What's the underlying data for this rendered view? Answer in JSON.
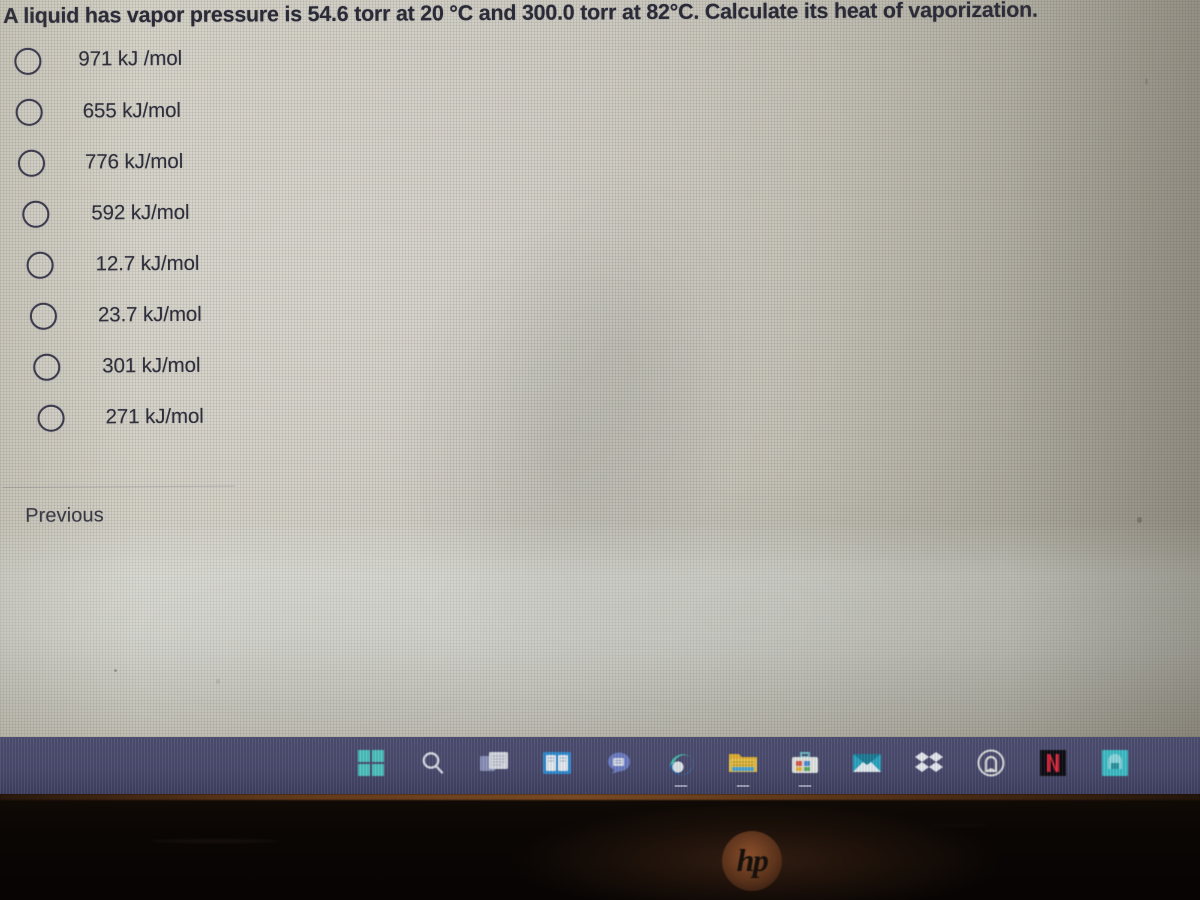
{
  "question": {
    "text": "A liquid has vapor pressure is 54.6 torr at 20 °C and 300.0 torr at 82°C. Calculate its heat of vaporization."
  },
  "options": [
    {
      "id": "opt-1",
      "label": "971 kJ /mol",
      "selected": false
    },
    {
      "id": "opt-2",
      "label": "655 kJ/mol",
      "selected": false
    },
    {
      "id": "opt-3",
      "label": "776 kJ/mol",
      "selected": false
    },
    {
      "id": "opt-4",
      "label": "592 kJ/mol",
      "selected": false
    },
    {
      "id": "opt-5",
      "label": "12.7 kJ/mol",
      "selected": false
    },
    {
      "id": "opt-6",
      "label": "23.7 kJ/mol",
      "selected": false
    },
    {
      "id": "opt-7",
      "label": "301 kJ/mol",
      "selected": false
    },
    {
      "id": "opt-8",
      "label": "271 kJ/mol",
      "selected": false
    }
  ],
  "navigation": {
    "previous_label": "Previous"
  },
  "taskbar": {
    "items": [
      {
        "name": "start",
        "icon": "windows-logo-icon",
        "running": false
      },
      {
        "name": "search",
        "icon": "search-icon",
        "running": false
      },
      {
        "name": "task-view",
        "icon": "task-view-icon",
        "running": false
      },
      {
        "name": "widgets",
        "icon": "widgets-icon",
        "running": false
      },
      {
        "name": "chat",
        "icon": "chat-bubble-icon",
        "running": false
      },
      {
        "name": "edge",
        "icon": "edge-browser-icon",
        "running": true
      },
      {
        "name": "file-explorer",
        "icon": "file-explorer-icon",
        "running": true
      },
      {
        "name": "office",
        "icon": "office-toolbox-icon",
        "running": true
      },
      {
        "name": "mail",
        "icon": "mail-envelope-icon",
        "running": false
      },
      {
        "name": "dropbox",
        "icon": "dropbox-icon",
        "running": false
      },
      {
        "name": "ring-app",
        "icon": "ring-logo-icon",
        "running": false
      },
      {
        "name": "netflix",
        "icon": "netflix-n-icon",
        "running": false
      },
      {
        "name": "teal-app",
        "icon": "teal-app-icon",
        "running": false
      }
    ]
  },
  "device": {
    "brand_label": "hp"
  },
  "colors": {
    "screen_background": "#cac7bd",
    "text_primary": "#30303e",
    "radio_outline": "#3b3a52",
    "taskbar_background": "#4a4b6e",
    "bezel": "#0a0604",
    "hp_logo": "#96562f"
  }
}
